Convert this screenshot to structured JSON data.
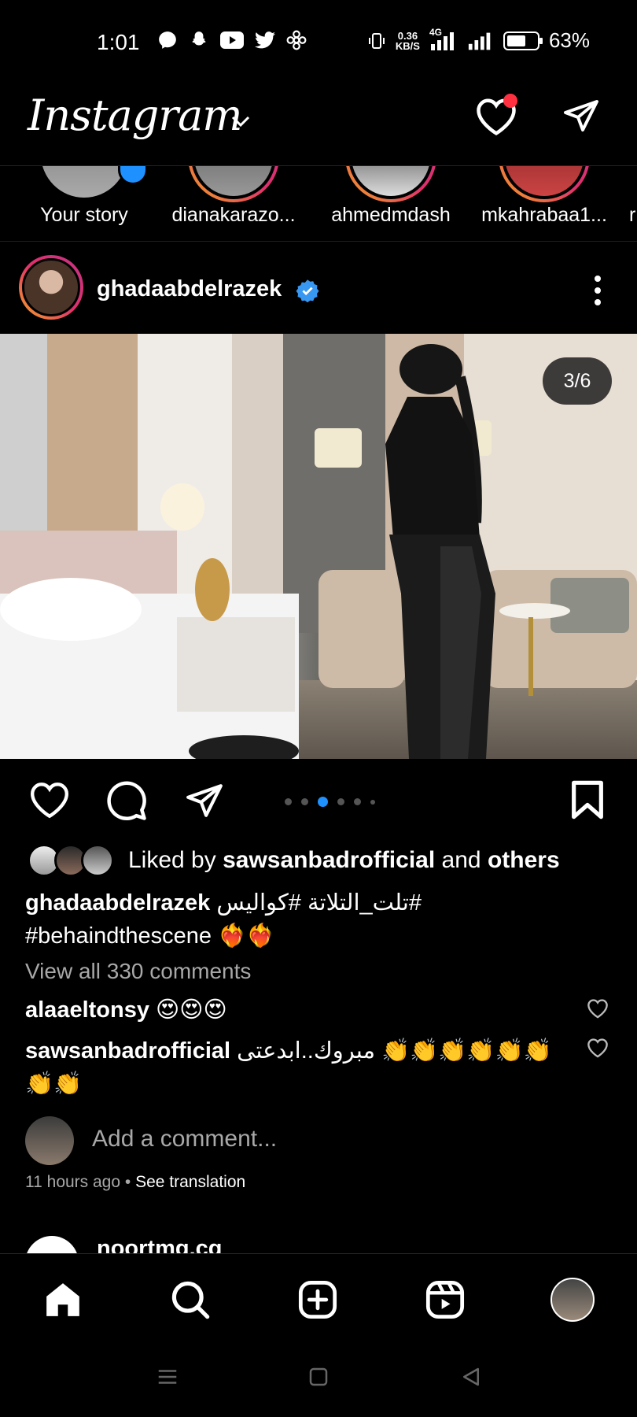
{
  "status_bar": {
    "time": "1:01",
    "net_speed_value": "0.36",
    "net_speed_unit": "KB/S",
    "network": "4G",
    "battery_percent": "63%",
    "battery_level": 0.63,
    "left_icons": [
      "messenger-icon",
      "snapchat-icon",
      "youtube-icon",
      "twitter-icon",
      "pinwheel-icon"
    ]
  },
  "header": {
    "logo": "Instagram",
    "has_notification": true
  },
  "stories": [
    {
      "label": "Your story",
      "own": true
    },
    {
      "label": "dianakarazo..."
    },
    {
      "label": "ahmedmdash"
    },
    {
      "label": "mkahrabaa1..."
    },
    {
      "label": "r"
    }
  ],
  "post": {
    "username": "ghadaabdelrazek",
    "verified": true,
    "counter": "3/6",
    "carousel": {
      "total_dots": 6,
      "active_index": 2
    },
    "liked_by_prefix": "Liked by",
    "liked_by_user": "sawsanbadrofficial",
    "liked_by_and": "and",
    "liked_by_others": "others",
    "caption_user": "ghadaabdelrazek",
    "caption_text": "#تلت_التلاتة #كواليس",
    "caption_line2": "#behaindthescene ❤️‍🔥❤️‍🔥",
    "view_all_comments": "View all 330 comments",
    "comments": [
      {
        "user": "alaaeltonsy",
        "text": "😍😍😍"
      },
      {
        "user": "sawsanbadrofficial",
        "text": "مبروك..ابدعتى 👏👏👏👏👏👏",
        "text2": "👏👏"
      }
    ],
    "add_comment_placeholder": "Add a comment...",
    "time_ago": "11 hours ago",
    "separator": "•",
    "see_translation": "See translation"
  },
  "next_post": {
    "username": "noortmg.cg"
  },
  "colors": {
    "accent_blue": "#1e90ff",
    "notification_red": "#ff3040",
    "muted_text": "#a8a8a8",
    "background": "#000000"
  }
}
